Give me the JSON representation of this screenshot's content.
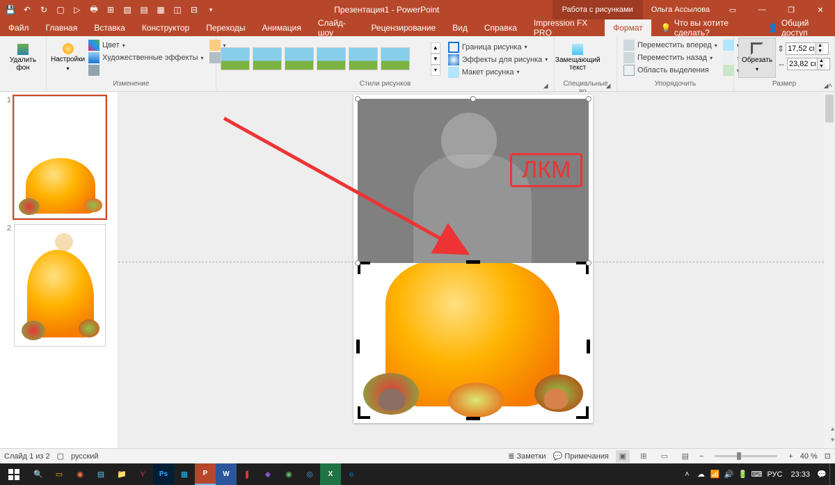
{
  "titlebar": {
    "doc_title": "Презентация1 - PowerPoint",
    "tools_tab": "Работа с рисунками",
    "user": "Ольга Ассылова"
  },
  "tabs": {
    "file": "Файл",
    "home": "Главная",
    "insert": "Вставка",
    "design": "Конструктор",
    "transitions": "Переходы",
    "animations": "Анимация",
    "slideshow": "Слайд-шоу",
    "review": "Рецензирование",
    "view": "Вид",
    "help": "Справка",
    "impression": "Impression FX PRO",
    "format": "Формат",
    "tellme": "Что вы хотите сделать?",
    "share": "Общий доступ"
  },
  "ribbon": {
    "remove_bg": "Удалить\nфон",
    "corrections": "Настройки",
    "color": "Цвет",
    "artistic": "Художественные эффекты",
    "g_adjust": "Изменение",
    "g_styles": "Стили рисунков",
    "border": "Граница рисунка",
    "effects": "Эффекты для рисунка",
    "layout": "Макет рисунка",
    "alt_text": "Замещающий\nтекст",
    "g_access": "Специальные во...",
    "bring_fwd": "Переместить вперед",
    "send_back": "Переместить назад",
    "sel_pane": "Область выделения",
    "g_arrange": "Упорядочить",
    "crop": "Обрезать",
    "g_size": "Размер",
    "height_val": "17,52 см",
    "width_val": "23,82 см"
  },
  "annotation": {
    "lkm": "ЛКМ"
  },
  "status": {
    "slide_count": "Слайд 1 из 2",
    "lang": "русский",
    "notes": "Заметки",
    "comments": "Примечания",
    "zoom": "40 %"
  },
  "thumbs": {
    "n1": "1",
    "n2": "2"
  },
  "taskbar": {
    "lang": "РУС",
    "time": "23:33"
  }
}
